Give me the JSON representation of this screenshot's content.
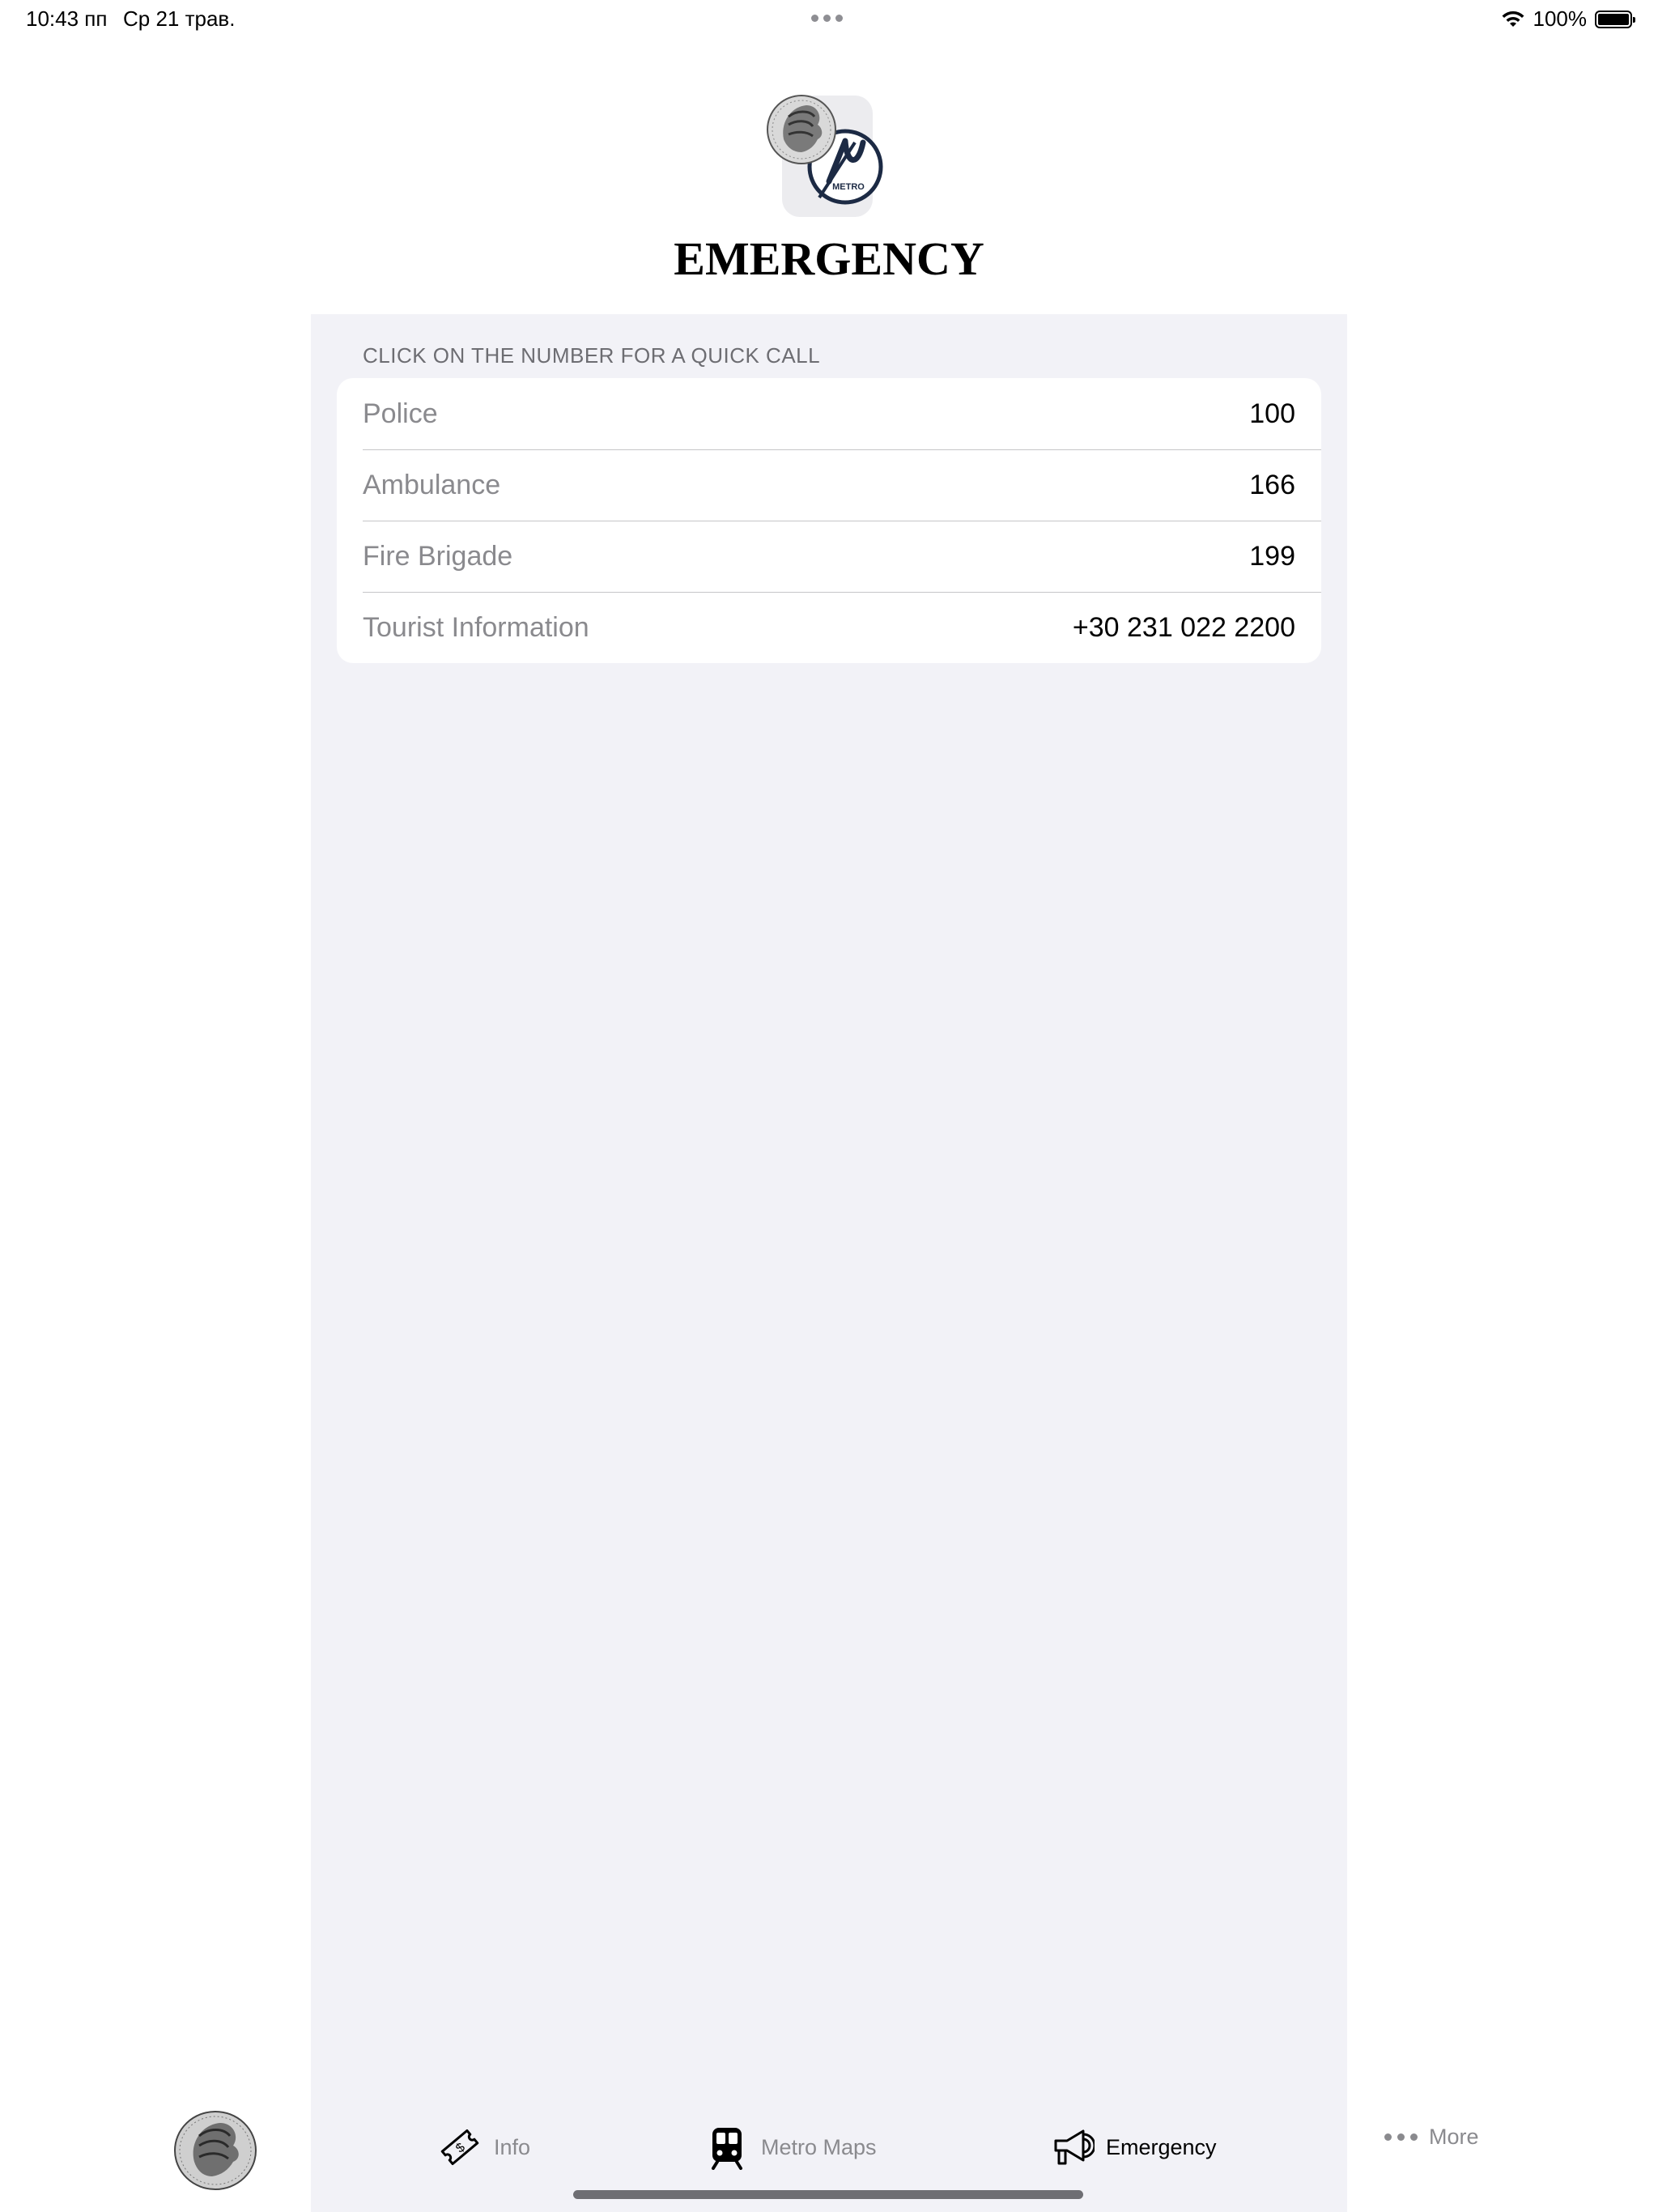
{
  "status_bar": {
    "time": "10:43 пп",
    "date": "Ср 21 трав.",
    "battery_percent": "100%",
    "battery_level": 1.0,
    "wifi_icon": "wifi-icon"
  },
  "header": {
    "title": "EMERGENCY",
    "logo_text": "METRO"
  },
  "emergency": {
    "section_header": "CLICK ON THE NUMBER FOR A QUICK CALL",
    "rows": [
      {
        "label": "Police",
        "number": "100"
      },
      {
        "label": "Ambulance",
        "number": "166"
      },
      {
        "label": "Fire Brigade",
        "number": "199"
      },
      {
        "label": "Tourist Information",
        "number": "+30 231 022 2200"
      }
    ]
  },
  "tab_bar": {
    "tabs": [
      {
        "label": "Info",
        "icon": "ticket-icon",
        "active": false
      },
      {
        "label": "Metro Maps",
        "icon": "tram-icon",
        "active": false
      },
      {
        "label": "Emergency",
        "icon": "megaphone-icon",
        "active": true
      },
      {
        "label": "More",
        "icon": "more-dots-icon",
        "active": false
      }
    ]
  },
  "colors": {
    "panel_background": "#f2f2f7",
    "inactive_tab": "#8a8a8e",
    "logo_navy": "#1c2a44"
  }
}
